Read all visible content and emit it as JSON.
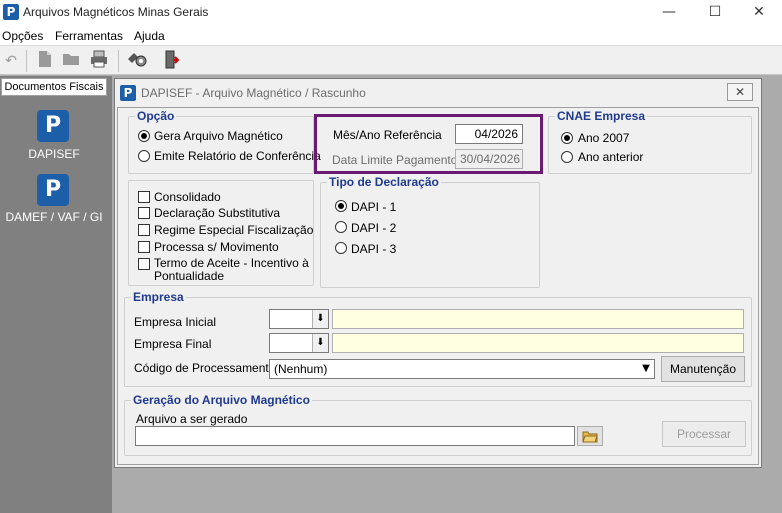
{
  "app": {
    "title": "Arquivos Magnéticos Minas Gerais",
    "icon": "P",
    "window_controls": [
      "—",
      "☐",
      "✕"
    ]
  },
  "menu": {
    "items": [
      "Opções",
      "Ferramentas",
      "Ajuda"
    ]
  },
  "toolbar": {
    "icons": [
      "undo-icon",
      "new-document-icon",
      "open-icon",
      "print-icon",
      "tools-icon",
      "exit-icon"
    ]
  },
  "sidebar": {
    "header": "Documentos Fiscais",
    "items": [
      {
        "label": "DAPISEF",
        "icon": "P"
      },
      {
        "label": "DAMEF / VAF / GI",
        "icon": "P"
      }
    ]
  },
  "window": {
    "title": "DAPISEF - Arquivo Magnético / Rascunho",
    "close": "✕",
    "opcao": {
      "title": "Opção",
      "options": [
        "Gera Arquivo Magnético",
        "Emite Relatório de Conferência"
      ],
      "selected_index": 0
    },
    "referencia": {
      "mes_ano_label": "Mês/Ano Referência",
      "mes_ano_value": "04/2026",
      "data_limite_label": "Data Limite Pagamento",
      "data_limite_value": "30/04/2026",
      "highlight_color": "#6b1a74"
    },
    "cnae": {
      "title": "CNAE Empresa",
      "options": [
        "Ano 2007",
        "Ano anterior"
      ],
      "selected_index": 0
    },
    "checkboxes": [
      "Consolidado",
      "Declaração Substitutiva",
      "Regime Especial Fiscalização",
      "Processa s/ Movimento",
      "Termo de Aceite - Incentivo à",
      "Pontualidade"
    ],
    "tipo": {
      "title": "Tipo de Declaração",
      "options": [
        "DAPI - 1",
        "DAPI - 2",
        "DAPI - 3"
      ],
      "selected_index": 0
    },
    "empresa": {
      "title": "Empresa",
      "inicial_label": "Empresa Inicial",
      "final_label": "Empresa Final",
      "codigo_label": "Código de Processamento",
      "codigo_value": "(Nenhum)",
      "manutencao_label": "Manutenção"
    },
    "geracao": {
      "title": "Geração do Arquivo Magnético",
      "arquivo_label": "Arquivo a ser gerado",
      "arquivo_value": "",
      "processar_label": "Processar"
    }
  }
}
